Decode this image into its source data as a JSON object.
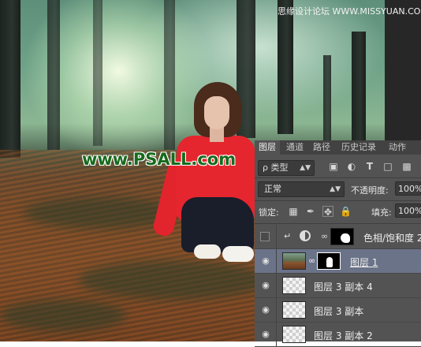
{
  "watermarks": {
    "site": "www.PSALL.com",
    "top_right": "思缘设计论坛 WWW.MISSYUAN.COM"
  },
  "layers_panel": {
    "tabs": [
      "图层",
      "通道",
      "路径",
      "历史记录",
      "动作"
    ],
    "active_tab_index": 0,
    "filter": {
      "label": "ρ 类型"
    },
    "blend_mode": "正常",
    "opacity_label": "不透明度:",
    "opacity_value": "100%",
    "lock_label": "锁定:",
    "fill_label": "填充:",
    "fill_value": "100%",
    "layers": [
      {
        "name": "色相/饱和度 2",
        "visible": false,
        "selected": false,
        "type": "adjustment"
      },
      {
        "name": "图层 1",
        "visible": true,
        "selected": true,
        "type": "photo-with-mask"
      },
      {
        "name": "图层 3 副本 4",
        "visible": true,
        "selected": false,
        "type": "transparent"
      },
      {
        "name": "图层 3 副本",
        "visible": true,
        "selected": false,
        "type": "transparent"
      },
      {
        "name": "图层 3 副本 2",
        "visible": true,
        "selected": false,
        "type": "transparent"
      }
    ]
  },
  "colors": {
    "panel_bg": "#535353",
    "selected_layer": "#6a7388",
    "watermark_green": "#176a1c"
  }
}
